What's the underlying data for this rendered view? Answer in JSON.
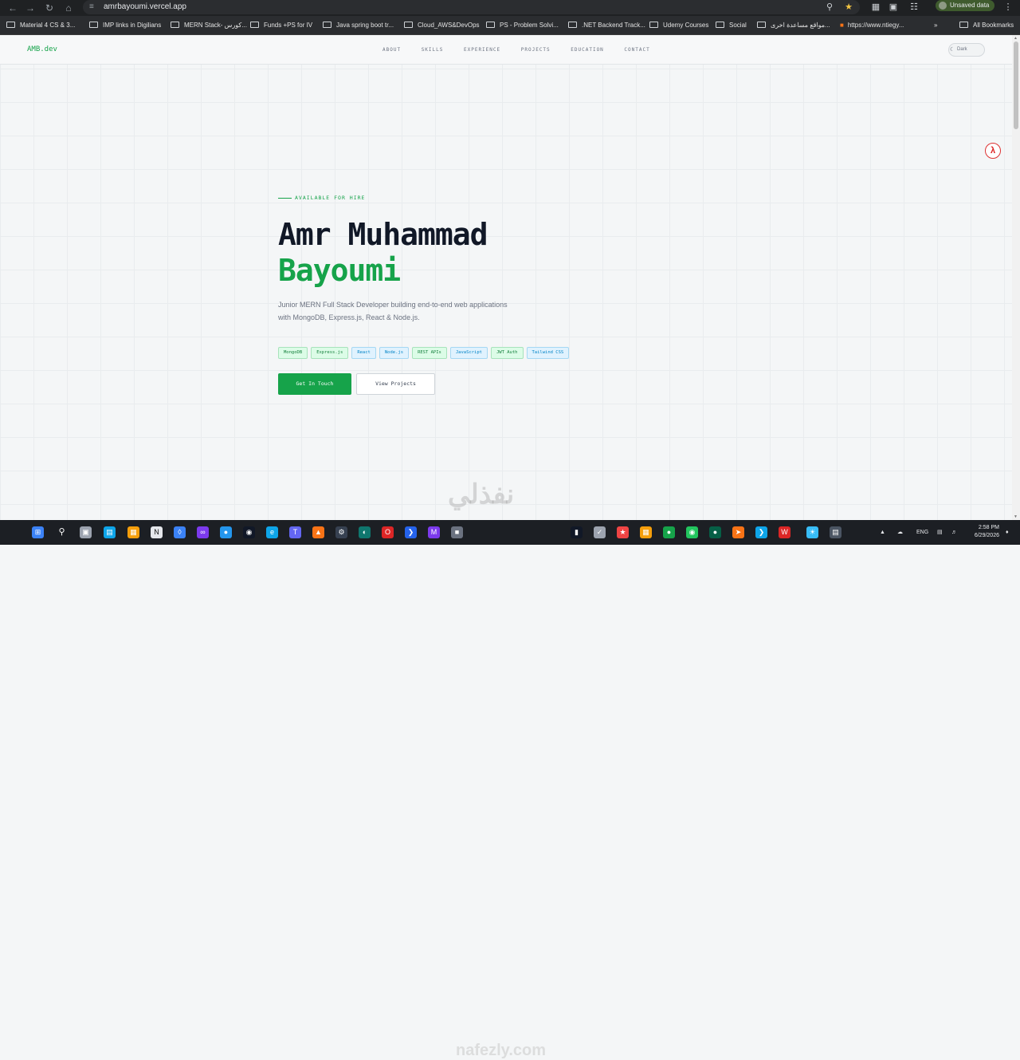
{
  "browser": {
    "url": "amrbayoumi.vercel.app",
    "profile_label": "Unsaved data",
    "bookmarks": [
      "Material 4 CS & 3...",
      "IMP links in Digilians",
      "MERN Stack- كورس...",
      "Funds +PS  for IV",
      "Java spring boot tr...",
      "Cloud_AWS&DevOps",
      "PS - Problem Solvi...",
      ".NET Backend Track...",
      "Udemy Courses",
      "Social",
      "مواقع مساعدة اخرى...",
      "https://www.ntiegy...",
      "All Bookmarks"
    ]
  },
  "site": {
    "logo": "AMB.dev",
    "nav": [
      "ABOUT",
      "SKILLS",
      "EXPERIENCE",
      "PROJECTS",
      "EDUCATION",
      "CONTACT"
    ],
    "theme_toggle": "Dark",
    "hero": {
      "availability": "AVAILABLE FOR HIRE",
      "name_line1": "Amr Muhammad",
      "name_line2": "Bayoumi",
      "description": "Junior MERN Full Stack Developer building end-to-end web applications with MongoDB, Express.js, React & Node.js.",
      "tags": [
        {
          "label": "MongoDB",
          "color": "#15803d"
        },
        {
          "label": "Express.js",
          "color": "#15803d"
        },
        {
          "label": "React",
          "color": "#0284c7"
        },
        {
          "label": "Node.js",
          "color": "#0284c7"
        },
        {
          "label": "REST APIs",
          "color": "#15803d"
        },
        {
          "label": "JavaScript",
          "color": "#0284c7"
        },
        {
          "label": "JWT Auth",
          "color": "#15803d"
        },
        {
          "label": "Tailwind CSS",
          "color": "#0284c7"
        }
      ],
      "primary_cta": "Get In Touch",
      "secondary_cta": "View Projects"
    },
    "accent_color": "#16a34a"
  },
  "taskbar": {
    "language": "ENG",
    "time": "2:58 PM",
    "date": "6/29/2026"
  },
  "watermark": "نفذلي",
  "watermark_brand": "nafezly.com"
}
